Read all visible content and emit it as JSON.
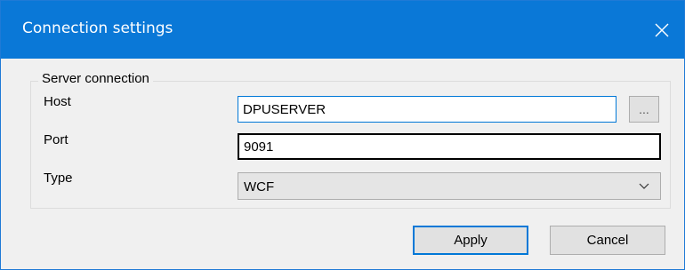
{
  "window": {
    "title": "Connection settings"
  },
  "group": {
    "legend": "Server connection"
  },
  "fields": {
    "host": {
      "label": "Host",
      "value": "DPUSERVER"
    },
    "port": {
      "label": "Port",
      "value": "9091"
    },
    "type": {
      "label": "Type",
      "value": "WCF"
    }
  },
  "browse_button_label": "...",
  "buttons": {
    "apply": "Apply",
    "cancel": "Cancel"
  },
  "icons": {
    "close": "close-icon",
    "dropdown": "chevron-down-icon"
  },
  "colors": {
    "titlebar": "#0a78d7",
    "focus_accent": "#0078d7",
    "dialog_background": "#f0f0f0"
  }
}
